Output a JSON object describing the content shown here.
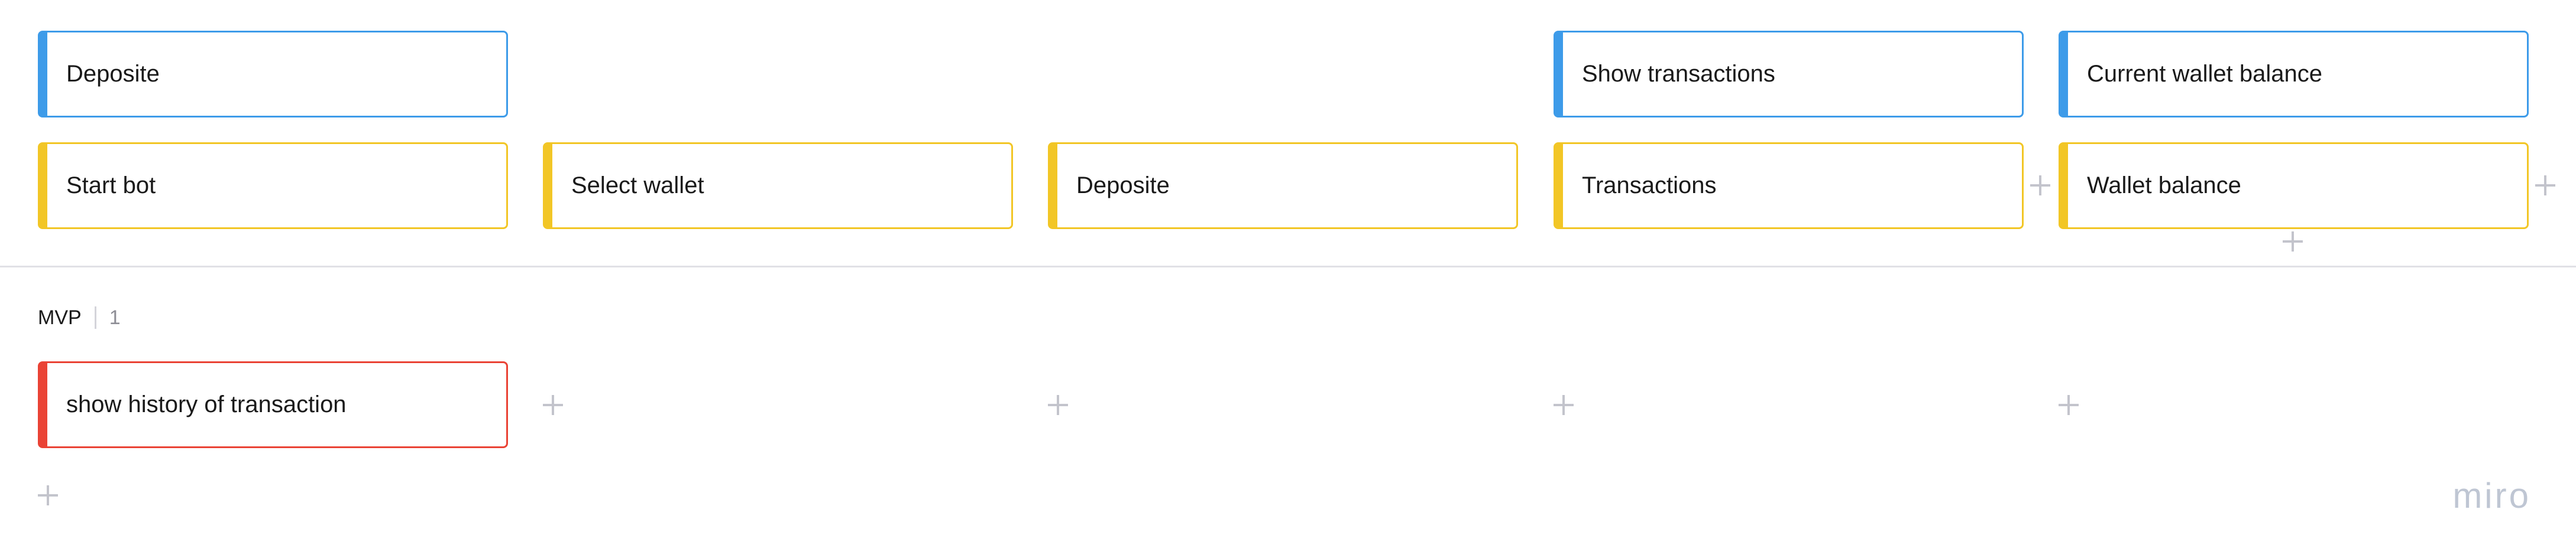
{
  "activities": {
    "deposite": "Deposite",
    "show_transactions": "Show transactions",
    "current_wallet_balance": "Current wallet balance"
  },
  "steps": {
    "start_bot": "Start bot",
    "select_wallet": "Select wallet",
    "deposite": "Deposite",
    "transactions": "Transactions",
    "wallet_balance": "Wallet balance"
  },
  "release": {
    "name": "MVP",
    "number": "1"
  },
  "release_cards": {
    "show_history": "show history of transaction"
  },
  "watermark": "miro",
  "colors": {
    "activity": "#3d9be9",
    "step": "#f2c626",
    "release_card": "#ea4335"
  },
  "icons": {
    "add": "plus-icon"
  }
}
